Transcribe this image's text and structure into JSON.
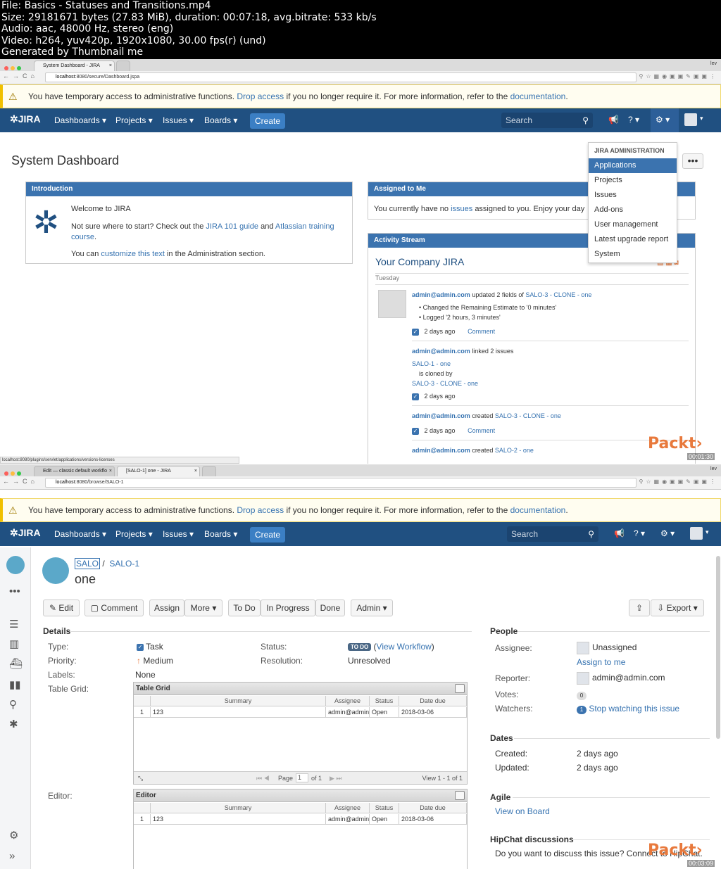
{
  "meta": {
    "file": "File: Basics - Statuses and Transitions.mp4",
    "size": "Size: 29181671 bytes (27.83 MiB), duration: 00:07:18, avg.bitrate: 533 kb/s",
    "audio": "Audio: aac, 48000 Hz, stereo (eng)",
    "video": "Video: h264, yuv420p, 1920x1080, 30.00 fps(r) (und)",
    "generated": "Generated by Thumbnail me"
  },
  "frame1": {
    "tab": "System Dashboard - JIRA",
    "user": "lev",
    "url_host": "localhost",
    "url_path": ":8080/secure/Dashboard.jspa",
    "timestamp": "00:01:30",
    "status_url": "localhost:8080/plugins/servlet/applications/versions-licenses",
    "page_title": "System Dashboard",
    "intro": {
      "header": "Introduction",
      "welcome": "Welcome to JIRA",
      "not_sure": "Not sure where to start? Check out the",
      "guide_link": "JIRA 101 guide",
      "and": "and",
      "training_link": "Atlassian training course",
      "you_can": "You can",
      "customize_link": "customize this text",
      "admin_section": "in the Administration section."
    },
    "assigned": {
      "header": "Assigned to Me",
      "text_a": "You currently have no",
      "issues_link": "issues",
      "text_b": "assigned to you. Enjoy your day"
    },
    "activity": {
      "header": "Activity Stream",
      "title": "Your Company JIRA",
      "day": "Tuesday",
      "entries": [
        {
          "user": "admin@admin.com",
          "action": "updated 2 fields of",
          "target": "SALO-3 - CLONE - one",
          "bullet1": "Changed the Remaining Estimate to '0 minutes'",
          "bullet2": "Logged '2 hours, 3 minutes'",
          "time": "2 days ago",
          "comment": "Comment"
        },
        {
          "user": "admin@admin.com",
          "action": "linked 2 issues",
          "link1": "SALO-1 - one",
          "cloned": "is cloned by",
          "link2": "SALO-3 - CLONE - one",
          "time": "2 days ago"
        },
        {
          "user": "admin@admin.com",
          "action": "created",
          "target": "SALO-3 - CLONE - one",
          "time": "2 days ago",
          "comment": "Comment"
        },
        {
          "user": "admin@admin.com",
          "action": "created",
          "target": "SALO-2 - one"
        }
      ]
    },
    "dropdown": {
      "header": "JIRA ADMINISTRATION",
      "items": [
        "Applications",
        "Projects",
        "Issues",
        "Add-ons",
        "User management",
        "Latest upgrade report",
        "System"
      ]
    }
  },
  "common": {
    "warning_a": "You have temporary access to administrative functions.",
    "drop_access": "Drop access",
    "warning_b": "if you no longer require it. For more information, refer to the",
    "documentation": "documentation",
    "logo": "JIRA",
    "nav": [
      "Dashboards",
      "Projects",
      "Issues",
      "Boards"
    ],
    "create": "Create",
    "search_placeholder": "Search",
    "packt": "Packt›"
  },
  "frame2": {
    "tab1": "Edit — classic default workflo",
    "tab2": "[SALO-1] one - JIRA",
    "url_host": "localhost",
    "url_path": ":8080/browse/SALO-1",
    "timestamp": "00:03:09",
    "project_key": "SALO",
    "issue_key": "SALO-1",
    "summary": "one",
    "buttons": {
      "edit": "Edit",
      "comment": "Comment",
      "assign": "Assign",
      "more": "More",
      "todo": "To Do",
      "inprogress": "In Progress",
      "done": "Done",
      "admin": "Admin",
      "export": "Export"
    },
    "details": {
      "title": "Details",
      "type_label": "Type:",
      "type": "Task",
      "status_label": "Status:",
      "status": "TO DO",
      "view_workflow": "View Workflow",
      "priority_label": "Priority:",
      "priority": "Medium",
      "resolution_label": "Resolution:",
      "resolution": "Unresolved",
      "labels_label": "Labels:",
      "labels": "None",
      "grid_label": "Table Grid:",
      "editor_label": "Editor:"
    },
    "grid": {
      "title": "Table Grid",
      "columns": [
        "Summary",
        "Assignee",
        "Status",
        "Date due"
      ],
      "row": {
        "num": "1",
        "summary": "123",
        "assignee": "admin@admin",
        "status": "Open",
        "due": "2018-03-06"
      },
      "page": "Page",
      "page_num": "1",
      "of": "of 1",
      "view": "View 1 - 1 of 1"
    },
    "editor_grid": {
      "title": "Editor"
    },
    "people": {
      "title": "People",
      "assignee_label": "Assignee:",
      "assignee": "Unassigned",
      "assign_me": "Assign to me",
      "reporter_label": "Reporter:",
      "reporter": "admin@admin.com",
      "votes_label": "Votes:",
      "votes": "0",
      "watchers_label": "Watchers:",
      "watchers": "1",
      "stop_watching": "Stop watching this issue"
    },
    "dates": {
      "title": "Dates",
      "created_label": "Created:",
      "created": "2 days ago",
      "updated_label": "Updated:",
      "updated": "2 days ago"
    },
    "agile": {
      "title": "Agile",
      "view_board": "View on Board"
    },
    "hipchat": {
      "title": "HipChat discussions",
      "text": "Do you want to discuss this issue? Connect to HipChat."
    }
  }
}
